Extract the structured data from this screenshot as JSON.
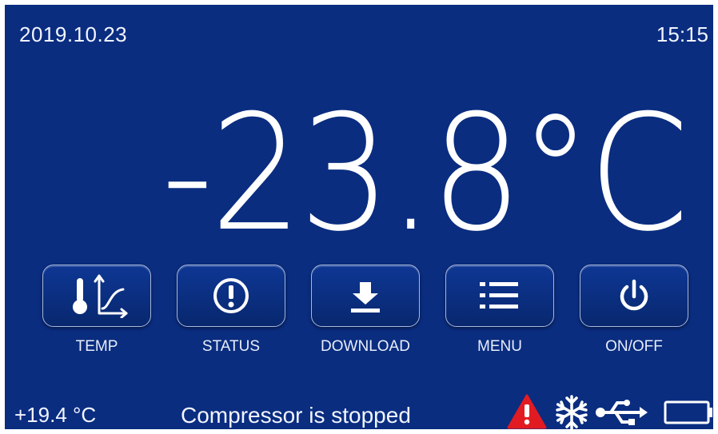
{
  "header": {
    "date": "2019.10.23",
    "time": "15:15"
  },
  "main": {
    "temperature": "-23.8°C"
  },
  "buttons": [
    {
      "id": "temp",
      "label": "TEMP",
      "icon": "thermometer-graph-icon"
    },
    {
      "id": "status",
      "label": "STATUS",
      "icon": "alert-circle-icon"
    },
    {
      "id": "download",
      "label": "DOWNLOAD",
      "icon": "download-icon"
    },
    {
      "id": "menu",
      "label": "MENU",
      "icon": "list-menu-icon"
    },
    {
      "id": "onoff",
      "label": "ON/OFF",
      "icon": "power-icon"
    }
  ],
  "footer": {
    "ambient_temperature": "+19.4 °C",
    "status_message": "Compressor is stopped",
    "icons": [
      "warning-triangle-icon",
      "snowflake-icon",
      "usb-icon",
      "battery-icon"
    ]
  },
  "colors": {
    "background": "#0a2d80",
    "text": "#f2f5ff",
    "warning": "#e21b22"
  }
}
